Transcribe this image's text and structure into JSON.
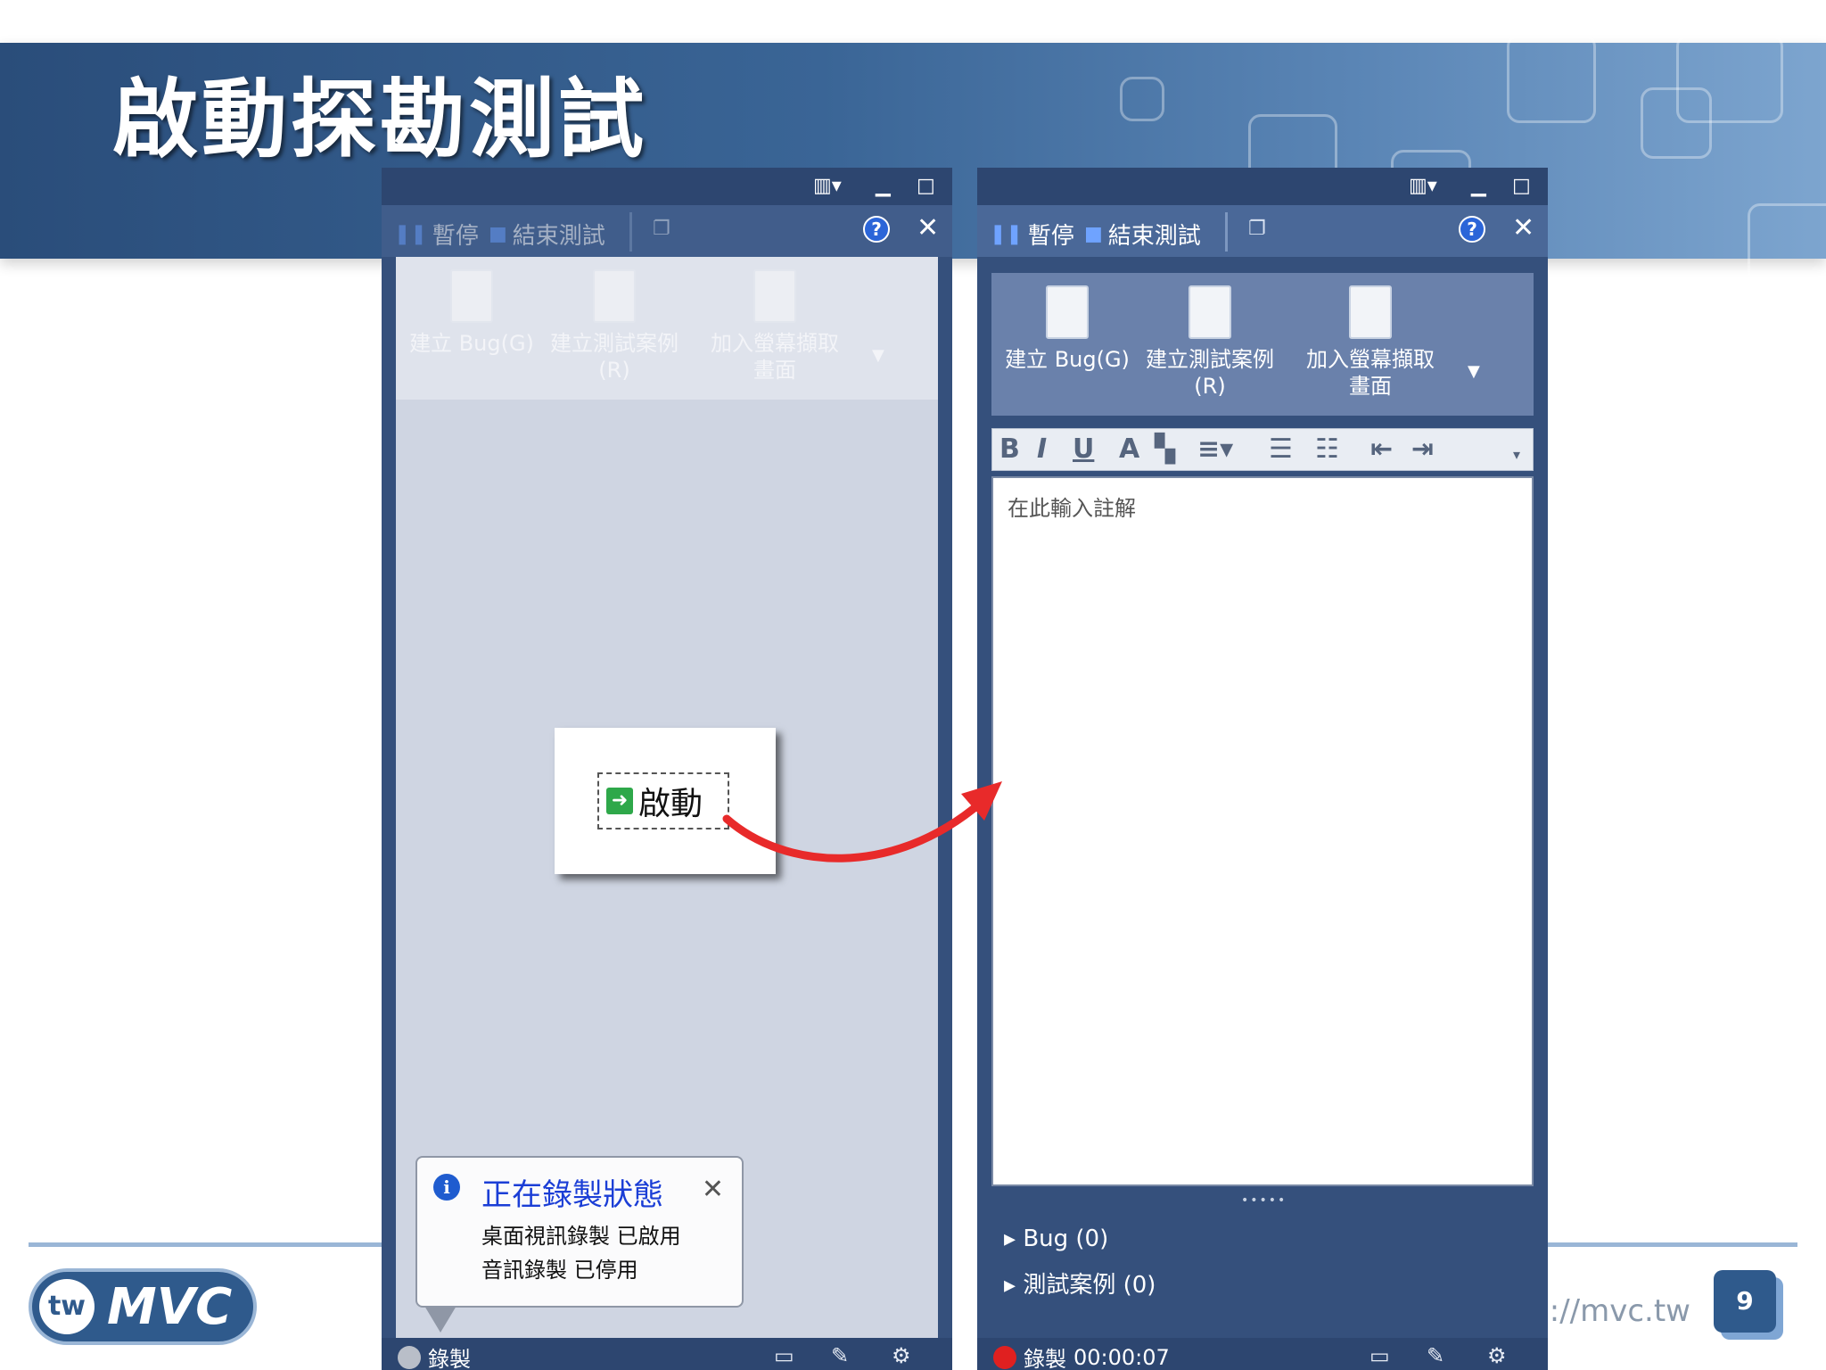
{
  "slide": {
    "title": "啟動探勘測試",
    "footer_url": "http://mvc.tw",
    "page_number": "9",
    "logo": {
      "badge": "tw",
      "text": "MVC"
    }
  },
  "panel_common": {
    "pause_label": "暫停",
    "end_test_label": "結束測試",
    "help_icon": "?",
    "close_icon": "✕",
    "ribbon": {
      "create_bug": "建立 Bug(G)",
      "create_test_case_line1": "建立測試案例",
      "create_test_case_line2": "(R)",
      "add_screenshot_line1": "加入螢幕擷取",
      "add_screenshot_line2": "畫面"
    }
  },
  "left_panel": {
    "launch_button": "啟動",
    "balloon": {
      "title": "正在錄製狀態",
      "line1": "桌面視訊錄製 已啟用",
      "line2": "音訊錄製 已停用"
    },
    "status": {
      "record_label": "錄製"
    }
  },
  "right_panel": {
    "comment_placeholder": "在此輸入註解",
    "tree": {
      "bug": "Bug (0)",
      "test_cases": "測試案例 (0)"
    },
    "status": {
      "record_label": "錄製",
      "elapsed": "00:00:07"
    }
  },
  "colors": {
    "banner": "#3a6596",
    "panel_bg": "#35507c",
    "toolbar": "#4a6898",
    "arrow": "#e82a2a",
    "record_active": "#e02020",
    "balloon_title": "#1b3ed6"
  }
}
